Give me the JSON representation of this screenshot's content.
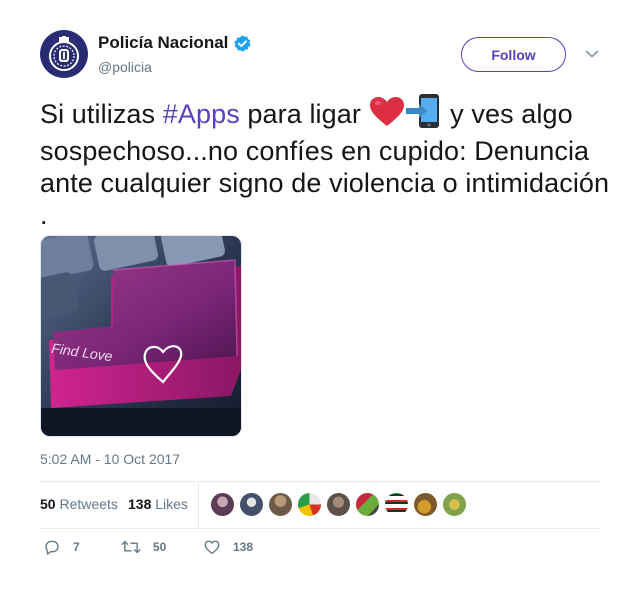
{
  "account": {
    "display_name": "Policía Nacional",
    "handle": "@policia",
    "verified": true,
    "avatar_icon": "police-badge-icon",
    "avatar_color": "#2a2c73"
  },
  "follow_button": {
    "label": "Follow",
    "color": "#5a3fbf"
  },
  "menu": {
    "icon": "chevron-down-icon"
  },
  "tweet": {
    "text_before_hashtag": "Si utilizas ",
    "hashtag": "#Apps",
    "text_after_hashtag": " para ligar ",
    "emojis": [
      "heart-emoji",
      "mobile-arrow-emoji"
    ],
    "text_end": " y ves algo sospechoso...no confíes en cupido: Denuncia ante cualquier signo de violencia o intimidación .",
    "hashtag_color": "#5a3fbf"
  },
  "media": {
    "key_label": "Find Love",
    "key_icon": "heart-outline-icon",
    "key_color": "#b2317f"
  },
  "timestamp": "5:02 AM - 10 Oct 2017",
  "stats": {
    "retweets_count": "50",
    "retweets_label": "Retweets",
    "likes_count": "138",
    "likes_label": "Likes",
    "liker_avatars": 9
  },
  "actions": {
    "reply": {
      "icon": "reply-icon",
      "count": "7"
    },
    "retweet": {
      "icon": "retweet-icon",
      "count": "50"
    },
    "like": {
      "icon": "heart-outline-icon",
      "count": "138"
    }
  }
}
